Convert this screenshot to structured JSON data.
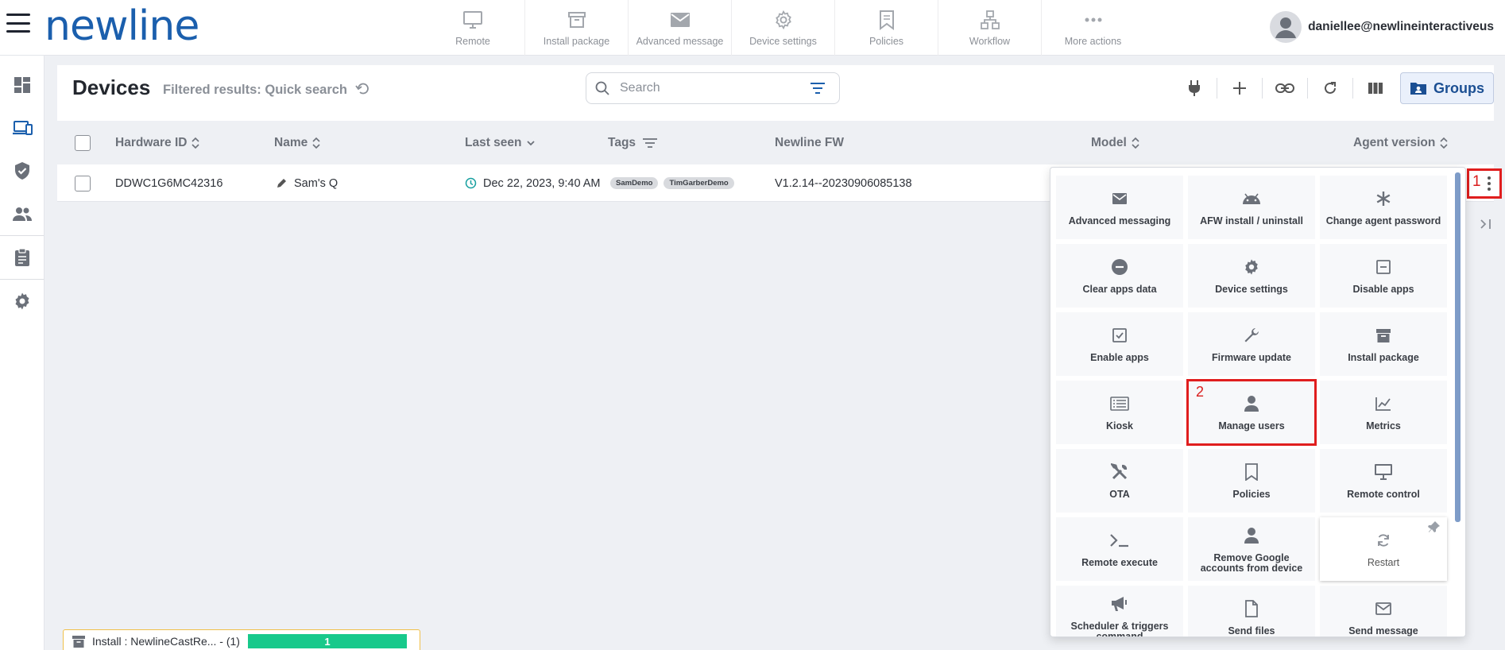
{
  "app": {
    "logo": "newline"
  },
  "topbar": {
    "actions": [
      {
        "label": "Remote",
        "icon": "monitor-icon"
      },
      {
        "label": "Install package",
        "icon": "archive-icon"
      },
      {
        "label": "Advanced message",
        "icon": "envelope-icon"
      },
      {
        "label": "Device settings",
        "icon": "gear-icon"
      },
      {
        "label": "Policies",
        "icon": "bookmark-icon"
      },
      {
        "label": "Workflow",
        "icon": "sitemap-icon"
      },
      {
        "label": "More actions",
        "icon": "ellipsis-icon"
      }
    ],
    "user_email": "daniellee@newlineinteractiveus"
  },
  "sidebar": {
    "items": [
      {
        "icon": "dashboard-icon"
      },
      {
        "icon": "devices-icon",
        "active": true
      },
      {
        "icon": "shield-icon"
      },
      {
        "icon": "users-icon"
      },
      {
        "icon": "clipboard-icon"
      },
      {
        "icon": "gear-icon"
      }
    ]
  },
  "devices": {
    "title": "Devices",
    "filter_text": "Filtered results: Quick search",
    "search_placeholder": "Search",
    "groups_label": "Groups",
    "columns": [
      "Hardware ID",
      "Name",
      "Last seen",
      "Tags",
      "Newline FW",
      "Model",
      "Agent version"
    ],
    "rows": [
      {
        "hardware_id": "DDWC1G6MC42316",
        "name": "Sam's Q",
        "last_seen": "Dec 22, 2023, 9:40 AM",
        "tags": [
          "SamDemo",
          "TimGarberDemo"
        ],
        "firmware": "V1.2.14--20230906085138"
      }
    ]
  },
  "more_menu": {
    "annotation": "1",
    "items": [
      {
        "label": "Advanced messaging",
        "icon": "envelope-icon"
      },
      {
        "label": "AFW install / uninstall",
        "icon": "android-icon"
      },
      {
        "label": "Change agent password",
        "icon": "asterisk-icon"
      },
      {
        "label": "Clear apps data",
        "icon": "minus-circle-icon"
      },
      {
        "label": "Device settings",
        "icon": "gear-icon"
      },
      {
        "label": "Disable apps",
        "icon": "minus-square-icon"
      },
      {
        "label": "Enable apps",
        "icon": "check-square-icon"
      },
      {
        "label": "Firmware update",
        "icon": "wrench-icon"
      },
      {
        "label": "Install package",
        "icon": "archive-icon"
      },
      {
        "label": "Kiosk",
        "icon": "list-icon"
      },
      {
        "label": "Manage users",
        "icon": "user-icon",
        "highlighted": true,
        "annotation": "2"
      },
      {
        "label": "Metrics",
        "icon": "chart-line-icon"
      },
      {
        "label": "OTA",
        "icon": "tools-icon"
      },
      {
        "label": "Policies",
        "icon": "bookmark-icon"
      },
      {
        "label": "Remote control",
        "icon": "monitor-icon"
      },
      {
        "label": "Remote execute",
        "icon": "terminal-icon"
      },
      {
        "label": "Remove Google accounts from device",
        "icon": "user-icon"
      },
      {
        "label": "Restart",
        "icon": "refresh-icon",
        "pinned": true
      },
      {
        "label": "Scheduler & triggers command",
        "icon": "megaphone-icon"
      },
      {
        "label": "Send files",
        "icon": "file-icon"
      },
      {
        "label": "Send message",
        "icon": "envelope-icon"
      }
    ]
  },
  "toast": {
    "text": "Install : NewlineCastRe...",
    "count_text": "- (1)",
    "progress_value": "1",
    "progress_fraction": 1.0
  },
  "colors": {
    "brand": "#1b5fad",
    "annotation_red": "#e01e1e",
    "progress_green": "#18c98b",
    "icon_gray": "#6b7079"
  }
}
